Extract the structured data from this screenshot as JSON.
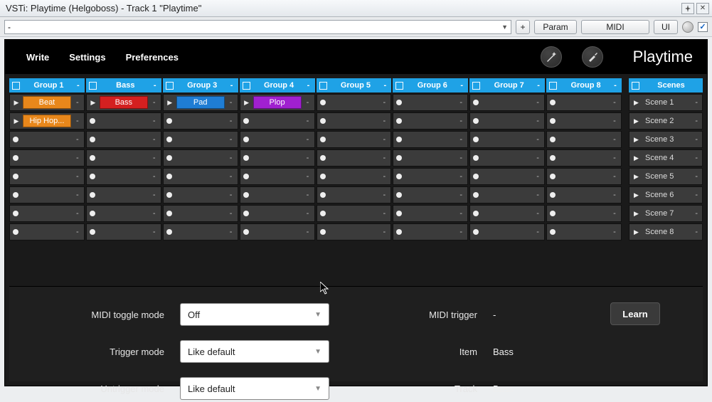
{
  "window_title": "VSTi: Playtime (Helgoboss) - Track 1 \"Playtime\"",
  "param_row": {
    "preset": "-",
    "plus": "+",
    "param": "Param",
    "midi": "MIDI",
    "ui": "UI"
  },
  "topbar": {
    "write": "Write",
    "settings": "Settings",
    "preferences": "Preferences",
    "brand": "Playtime"
  },
  "groups": [
    {
      "name": "Group 1",
      "cells": [
        {
          "type": "clip",
          "label": "Beat",
          "color": "orange"
        },
        {
          "type": "clip",
          "label": "Hip Hop...",
          "color": "orange"
        },
        {
          "type": "empty"
        },
        {
          "type": "empty"
        },
        {
          "type": "empty"
        },
        {
          "type": "empty"
        },
        {
          "type": "empty"
        },
        {
          "type": "empty"
        }
      ]
    },
    {
      "name": "Bass",
      "cells": [
        {
          "type": "clip",
          "label": "Bass",
          "color": "red"
        },
        {
          "type": "empty"
        },
        {
          "type": "empty"
        },
        {
          "type": "empty"
        },
        {
          "type": "empty"
        },
        {
          "type": "empty"
        },
        {
          "type": "empty"
        },
        {
          "type": "empty"
        }
      ]
    },
    {
      "name": "Group 3",
      "cells": [
        {
          "type": "clip",
          "label": "Pad",
          "color": "blue"
        },
        {
          "type": "empty"
        },
        {
          "type": "empty"
        },
        {
          "type": "empty"
        },
        {
          "type": "empty"
        },
        {
          "type": "empty"
        },
        {
          "type": "empty"
        },
        {
          "type": "empty"
        }
      ]
    },
    {
      "name": "Group 4",
      "cells": [
        {
          "type": "clip",
          "label": "Plop",
          "color": "purple"
        },
        {
          "type": "empty"
        },
        {
          "type": "empty"
        },
        {
          "type": "empty"
        },
        {
          "type": "empty"
        },
        {
          "type": "empty"
        },
        {
          "type": "empty"
        },
        {
          "type": "empty"
        }
      ]
    },
    {
      "name": "Group 5",
      "cells": [
        {
          "type": "empty"
        },
        {
          "type": "empty"
        },
        {
          "type": "empty"
        },
        {
          "type": "empty"
        },
        {
          "type": "empty"
        },
        {
          "type": "empty"
        },
        {
          "type": "empty"
        },
        {
          "type": "empty"
        }
      ]
    },
    {
      "name": "Group 6",
      "cells": [
        {
          "type": "empty"
        },
        {
          "type": "empty"
        },
        {
          "type": "empty"
        },
        {
          "type": "empty"
        },
        {
          "type": "empty"
        },
        {
          "type": "empty"
        },
        {
          "type": "empty"
        },
        {
          "type": "empty"
        }
      ]
    },
    {
      "name": "Group 7",
      "cells": [
        {
          "type": "empty"
        },
        {
          "type": "empty"
        },
        {
          "type": "empty"
        },
        {
          "type": "empty"
        },
        {
          "type": "empty"
        },
        {
          "type": "empty"
        },
        {
          "type": "empty"
        },
        {
          "type": "empty"
        }
      ]
    },
    {
      "name": "Group 8",
      "cells": [
        {
          "type": "empty"
        },
        {
          "type": "empty"
        },
        {
          "type": "empty"
        },
        {
          "type": "empty"
        },
        {
          "type": "empty"
        },
        {
          "type": "empty"
        },
        {
          "type": "empty"
        },
        {
          "type": "empty"
        }
      ]
    }
  ],
  "scenes_header": "Scenes",
  "scenes": [
    "Scene 1",
    "Scene 2",
    "Scene 3",
    "Scene 4",
    "Scene 5",
    "Scene 6",
    "Scene 7",
    "Scene 8"
  ],
  "props": {
    "midi_toggle_label": "MIDI toggle mode",
    "midi_toggle_value": "Off",
    "trigger_label": "Trigger mode",
    "trigger_value": "Like default",
    "untrigger_label": "Untrigger mode",
    "untrigger_value": "Like default",
    "midi_trigger_label": "MIDI trigger",
    "midi_trigger_value": "-",
    "item_label": "Item",
    "item_value": "Bass",
    "track_label": "Track",
    "track_value": "Bass",
    "learn": "Learn"
  }
}
